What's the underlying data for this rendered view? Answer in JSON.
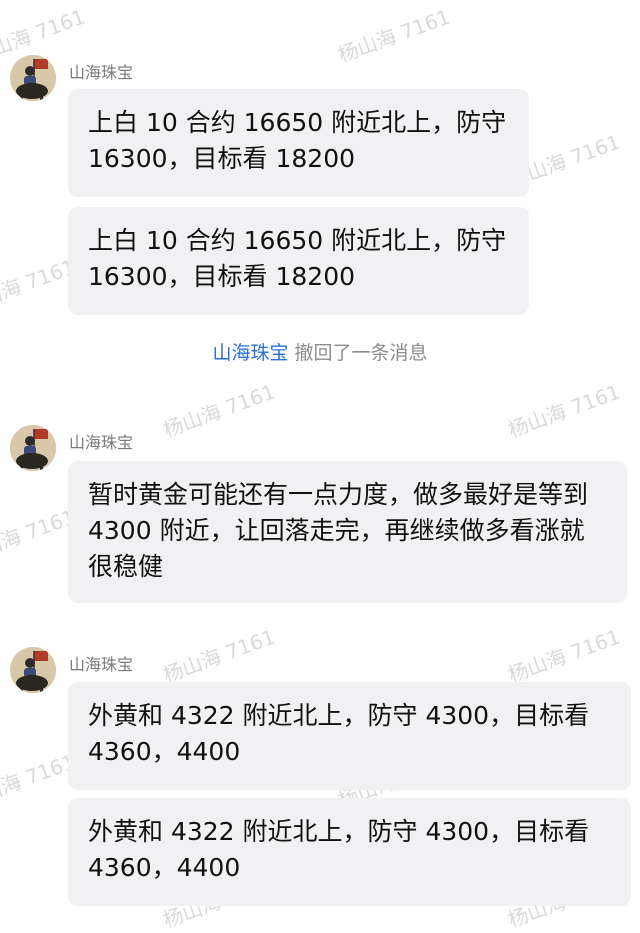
{
  "watermark": "杨山海 7161",
  "messages": [
    {
      "sender": "山海珠宝",
      "text": "上白 10 合约 16650 附近北上，防守 16300，目标看 18200"
    },
    {
      "sender": "",
      "text": "上白 10 合约 16650 附近北上，防守 16300，目标看 18200"
    },
    {
      "sender": "山海珠宝",
      "text": "暂时黄金可能还有一点力度，做多最好是等到 4300 附近，让回落走完，再继续做多看涨就很稳健"
    },
    {
      "sender": "山海珠宝",
      "text": "外黄和 4322 附近北上，防守 4300，目标看 4360，4400"
    },
    {
      "sender": "",
      "text": "外黄和 4322 附近北上，防守 4300，目标看 4360，4400"
    }
  ],
  "recall_notice": {
    "who": "山海珠宝",
    "action": "撤回了一条消息"
  },
  "colors": {
    "link": "#2a6fd6",
    "bubble": "#f1f1f3",
    "muted": "#8c8c8c"
  }
}
